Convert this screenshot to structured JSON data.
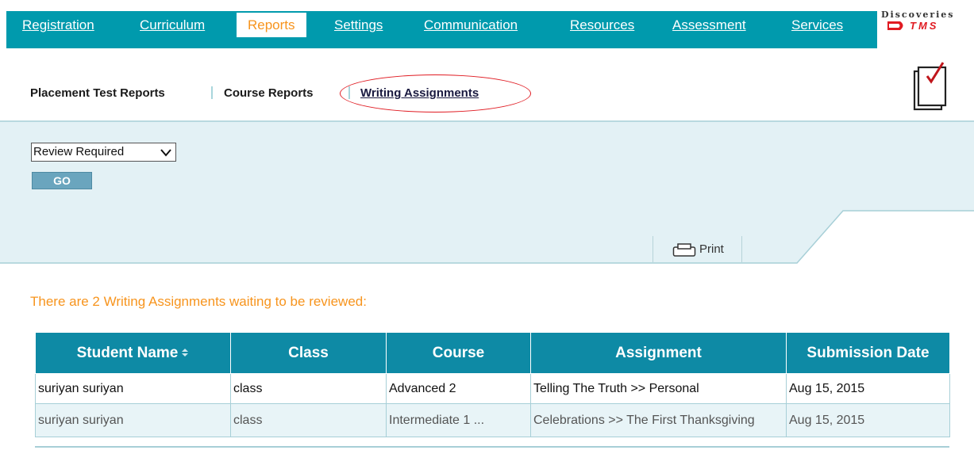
{
  "nav": {
    "tabs": [
      {
        "label": "Registration",
        "active": false
      },
      {
        "label": "Curriculum",
        "active": false
      },
      {
        "label": "Reports",
        "active": true
      },
      {
        "label": "Settings",
        "active": false
      },
      {
        "label": "Communication",
        "active": false
      },
      {
        "label": "Resources",
        "active": false
      },
      {
        "label": "Assessment",
        "active": false
      },
      {
        "label": "Services",
        "active": false
      }
    ]
  },
  "logo": {
    "top_text": "Discoveries",
    "tms_text": "TMS"
  },
  "subnav": {
    "items": [
      {
        "label": "Placement Test Reports"
      },
      {
        "label": "Course Reports"
      },
      {
        "label": "Writing Assignments",
        "selected": true
      }
    ]
  },
  "filter": {
    "status_value": "Review Required",
    "go_label": "GO",
    "print_label": "Print"
  },
  "message": "There are 2 Writing Assignments waiting to be reviewed:",
  "table": {
    "columns": [
      "Student Name",
      "Class",
      "Course",
      "Assignment",
      "Submission Date"
    ],
    "rows": [
      [
        "suriyan suriyan",
        "class",
        "Advanced 2",
        "Telling The Truth >> Personal",
        "Aug 15, 2015"
      ],
      [
        "suriyan suriyan",
        "class",
        "Intermediate 1 ...",
        "Celebrations >> The First Thanksgiving",
        "Aug 15, 2015"
      ]
    ]
  },
  "colors": {
    "nav_bg": "#009aad",
    "accent_orange": "#f7941d",
    "panel_bg": "#e3f1f5",
    "table_header_bg": "#0e8aa5",
    "highlight_red": "#e01b22"
  },
  "icons": {
    "logo": "discoveries-logo",
    "notepad": "notepad-check-icon",
    "print": "printer-icon",
    "dropdown": "chevron-down-icon",
    "sort": "sort-arrows-icon"
  }
}
